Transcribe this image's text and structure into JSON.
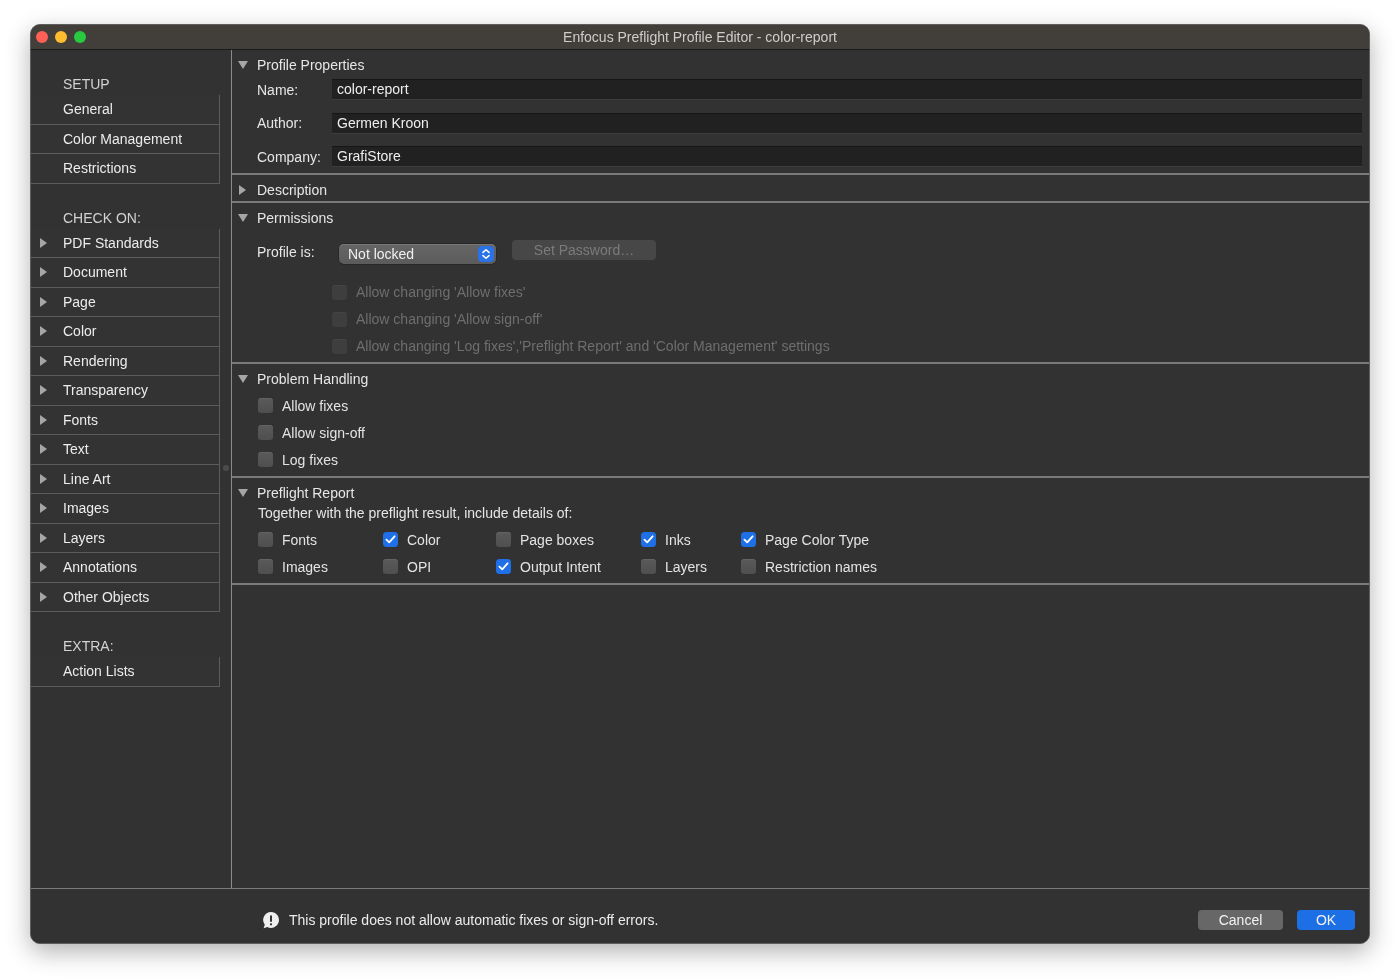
{
  "window": {
    "title": "Enfocus Preflight Profile Editor - color-report"
  },
  "sidebar": {
    "sections": [
      {
        "heading": "SETUP",
        "items": [
          {
            "label": "General"
          },
          {
            "label": "Color Management"
          },
          {
            "label": "Restrictions"
          }
        ]
      },
      {
        "heading": "CHECK ON:",
        "items": [
          {
            "label": "PDF Standards",
            "expanded": false
          },
          {
            "label": "Document",
            "expanded": false
          },
          {
            "label": "Page",
            "expanded": false
          },
          {
            "label": "Color",
            "expanded": false
          },
          {
            "label": "Rendering",
            "expanded": false
          },
          {
            "label": "Transparency",
            "expanded": false
          },
          {
            "label": "Fonts",
            "expanded": false
          },
          {
            "label": "Text",
            "expanded": false
          },
          {
            "label": "Line Art",
            "expanded": false
          },
          {
            "label": "Images",
            "expanded": false
          },
          {
            "label": "Layers",
            "expanded": false
          },
          {
            "label": "Annotations",
            "expanded": false
          },
          {
            "label": "Other Objects",
            "expanded": false
          }
        ]
      },
      {
        "heading": "EXTRA:",
        "items": [
          {
            "label": "Action Lists"
          }
        ]
      }
    ]
  },
  "panels": [
    {
      "kind": "fields",
      "title": "Profile Properties",
      "expanded": true,
      "fields": [
        {
          "label": "Name:",
          "value": "color-report"
        },
        {
          "label": "Author:",
          "value": "Germen Kroon"
        },
        {
          "label": "Company:",
          "value": "GrafiStore"
        }
      ]
    },
    {
      "title": "Description",
      "expanded": false
    },
    {
      "kind": "permissions",
      "title": "Permissions",
      "expanded": true,
      "lock": {
        "label": "Profile is:",
        "value": "Not locked"
      },
      "password_button": {
        "label": "Set Password…",
        "disabled": true
      },
      "options": [
        {
          "label": "Allow changing 'Allow fixes'",
          "checked": false,
          "disabled": true
        },
        {
          "label": "Allow changing 'Allow sign-off'",
          "checked": false,
          "disabled": true
        },
        {
          "label": "Allow changing 'Log fixes','Preflight Report' and 'Color Management' settings",
          "checked": false,
          "disabled": true
        }
      ]
    },
    {
      "kind": "checklist",
      "title": "Problem Handling",
      "expanded": true,
      "options": [
        {
          "label": "Allow fixes",
          "checked": false,
          "disabled": false
        },
        {
          "label": "Allow sign-off",
          "checked": false,
          "disabled": false
        },
        {
          "label": "Log fixes",
          "checked": false,
          "disabled": false
        }
      ]
    },
    {
      "kind": "report",
      "title": "Preflight Report",
      "expanded": true,
      "intro": "Together with the preflight result, include details of:",
      "options": [
        {
          "label": "Fonts",
          "checked": false
        },
        {
          "label": "Color",
          "checked": true
        },
        {
          "label": "Page boxes",
          "checked": false
        },
        {
          "label": "Inks",
          "checked": true
        },
        {
          "label": "Page Color Type",
          "checked": true
        },
        {
          "label": "Images",
          "checked": false
        },
        {
          "label": "OPI",
          "checked": false
        },
        {
          "label": "Output Intent",
          "checked": true
        },
        {
          "label": "Layers",
          "checked": false
        },
        {
          "label": "Restriction names",
          "checked": false
        }
      ]
    }
  ],
  "footer": {
    "message": "This profile does not allow automatic fixes or sign-off errors.",
    "buttons": [
      {
        "label": "Cancel",
        "kind": "secondary"
      },
      {
        "label": "OK",
        "kind": "primary"
      }
    ]
  }
}
